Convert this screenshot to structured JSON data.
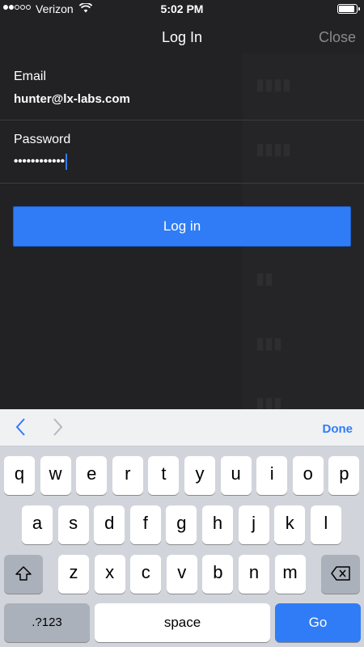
{
  "status": {
    "carrier": "Verizon",
    "time": "5:02 PM",
    "battery_level": 0.9
  },
  "nav": {
    "title": "Log In",
    "close_label": "Close"
  },
  "form": {
    "email_label": "Email",
    "email_value": "hunter@lx-labs.com",
    "password_label": "Password",
    "password_value": "••••••••••••"
  },
  "login_button": "Log in",
  "keyboard": {
    "done_label": "Done",
    "row1": [
      "q",
      "w",
      "e",
      "r",
      "t",
      "y",
      "u",
      "i",
      "o",
      "p"
    ],
    "row2": [
      "a",
      "s",
      "d",
      "f",
      "g",
      "h",
      "j",
      "k",
      "l"
    ],
    "row3": [
      "z",
      "x",
      "c",
      "v",
      "b",
      "n",
      "m"
    ],
    "numbers_label": ".?123",
    "space_label": "space",
    "go_label": "Go"
  }
}
